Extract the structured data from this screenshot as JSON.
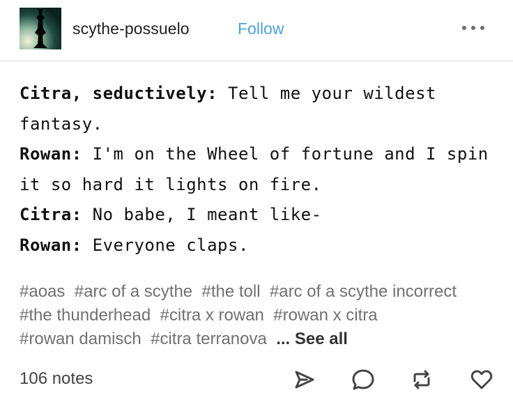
{
  "header": {
    "username": "scythe-possuelo",
    "follow_label": "Follow"
  },
  "post": {
    "lines": [
      {
        "speaker": "Citra, seductively:",
        "text": " Tell me your wildest fantasy."
      },
      {
        "speaker": "Rowan:",
        "text": " I'm on the Wheel of fortune and I spin it so hard it lights on fire."
      },
      {
        "speaker": "Citra:",
        "text": " No babe, I meant like-"
      },
      {
        "speaker": "Rowan:",
        "text": " Everyone claps."
      }
    ]
  },
  "tags": {
    "items": [
      "#aoas",
      "#arc of a scythe",
      "#the toll",
      "#arc of a scythe incorrect",
      "#the thunderhead",
      "#citra x rowan",
      "#rowan x citra",
      "#rowan damisch",
      "#citra terranova"
    ],
    "see_all_label": "... See all"
  },
  "footer": {
    "notes": "106 notes"
  },
  "icons": {
    "avatar": "avatar-image",
    "more": "more-icon",
    "share": "share-icon",
    "reply": "reply-icon",
    "reblog": "reblog-icon",
    "like": "heart-icon"
  },
  "colors": {
    "follow": "#4aa3df",
    "tags": "#707070",
    "icons": "#444444"
  }
}
